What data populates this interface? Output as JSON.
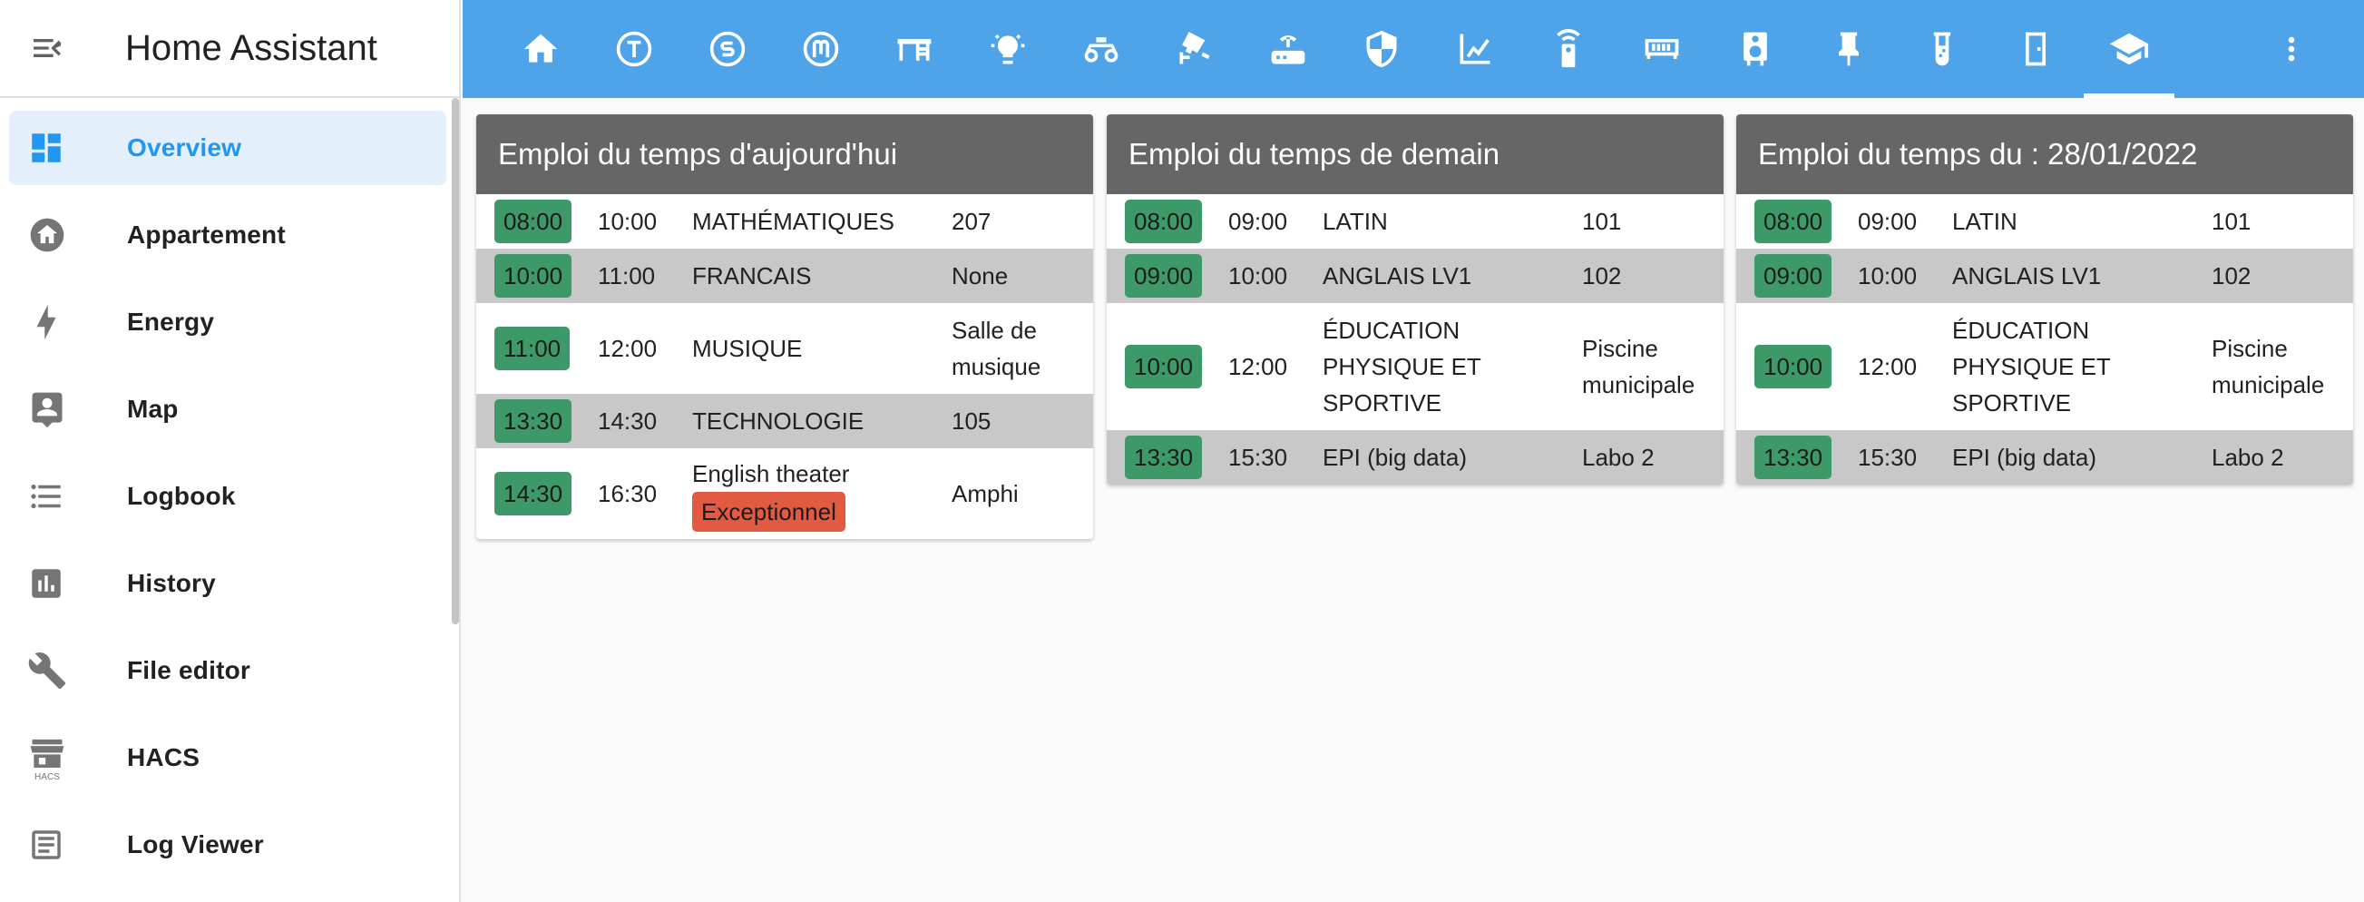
{
  "app": {
    "title": "Home Assistant"
  },
  "sidebar": {
    "items": [
      {
        "label": "Overview",
        "icon": "view-dashboard-icon",
        "active": true
      },
      {
        "label": "Appartement",
        "icon": "home-circle-icon"
      },
      {
        "label": "Energy",
        "icon": "lightning-bolt-icon"
      },
      {
        "label": "Map",
        "icon": "account-box-icon"
      },
      {
        "label": "Logbook",
        "icon": "format-list-bulleted-icon"
      },
      {
        "label": "History",
        "icon": "chart-box-icon"
      },
      {
        "label": "File editor",
        "icon": "wrench-icon"
      },
      {
        "label": "HACS",
        "icon": "hacs-store-icon",
        "icon_text": "HACS"
      },
      {
        "label": "Log Viewer",
        "icon": "text-box-icon"
      }
    ]
  },
  "topbar": {
    "tabs": [
      {
        "icon": "home-icon"
      },
      {
        "icon": "alpha-t-circle-icon",
        "glyph": "T"
      },
      {
        "icon": "alpha-s-circle-icon",
        "glyph": "S"
      },
      {
        "icon": "alpha-m-circle-icon",
        "glyph": "M"
      },
      {
        "icon": "desk-icon"
      },
      {
        "icon": "ceiling-light-icon"
      },
      {
        "icon": "robot-mower-icon"
      },
      {
        "icon": "cctv-icon"
      },
      {
        "icon": "router-icon"
      },
      {
        "icon": "shield-half-icon"
      },
      {
        "icon": "chart-line-icon"
      },
      {
        "icon": "remote-icon"
      },
      {
        "icon": "memory-icon"
      },
      {
        "icon": "speaker-icon"
      },
      {
        "icon": "pin-icon"
      },
      {
        "icon": "test-tube-icon"
      },
      {
        "icon": "door-icon"
      },
      {
        "icon": "school-icon",
        "active": true
      }
    ],
    "menu_icon": "dots-vertical-icon"
  },
  "colors": {
    "accent": "#4fa3e8",
    "card_header": "#666666",
    "time_badge": "#3d9a68",
    "exception_badge": "#e25a41",
    "odd_row": "#c8c8c8"
  },
  "cards": [
    {
      "title": "Emploi du temps d'aujourd'hui",
      "rows": [
        {
          "start": "08:00",
          "end": "10:00",
          "subject": "MATHÉMATIQUES",
          "room": "207"
        },
        {
          "start": "10:00",
          "end": "11:00",
          "subject": "FRANCAIS",
          "room": "None"
        },
        {
          "start": "11:00",
          "end": "12:00",
          "subject": "MUSIQUE",
          "room": "Salle de musique"
        },
        {
          "start": "13:30",
          "end": "14:30",
          "subject": "TECHNOLOGIE",
          "room": "105"
        },
        {
          "start": "14:30",
          "end": "16:30",
          "subject": "English theater",
          "status": "Exceptionnel",
          "room": "Amphi"
        }
      ]
    },
    {
      "title": "Emploi du temps de demain",
      "rows": [
        {
          "start": "08:00",
          "end": "09:00",
          "subject": "LATIN",
          "room": "101"
        },
        {
          "start": "09:00",
          "end": "10:00",
          "subject": "ANGLAIS LV1",
          "room": "102"
        },
        {
          "start": "10:00",
          "end": "12:00",
          "subject": "ÉDUCATION PHYSIQUE ET SPORTIVE",
          "room": "Piscine municipale"
        },
        {
          "start": "13:30",
          "end": "15:30",
          "subject": "EPI (big data)",
          "room": "Labo 2"
        }
      ]
    },
    {
      "title": "Emploi du temps du : 28/01/2022",
      "rows": [
        {
          "start": "08:00",
          "end": "09:00",
          "subject": "LATIN",
          "room": "101"
        },
        {
          "start": "09:00",
          "end": "10:00",
          "subject": "ANGLAIS LV1",
          "room": "102"
        },
        {
          "start": "10:00",
          "end": "12:00",
          "subject": "ÉDUCATION PHYSIQUE ET SPORTIVE",
          "room": "Piscine municipale"
        },
        {
          "start": "13:30",
          "end": "15:30",
          "subject": "EPI (big data)",
          "room": "Labo 2"
        }
      ]
    }
  ]
}
